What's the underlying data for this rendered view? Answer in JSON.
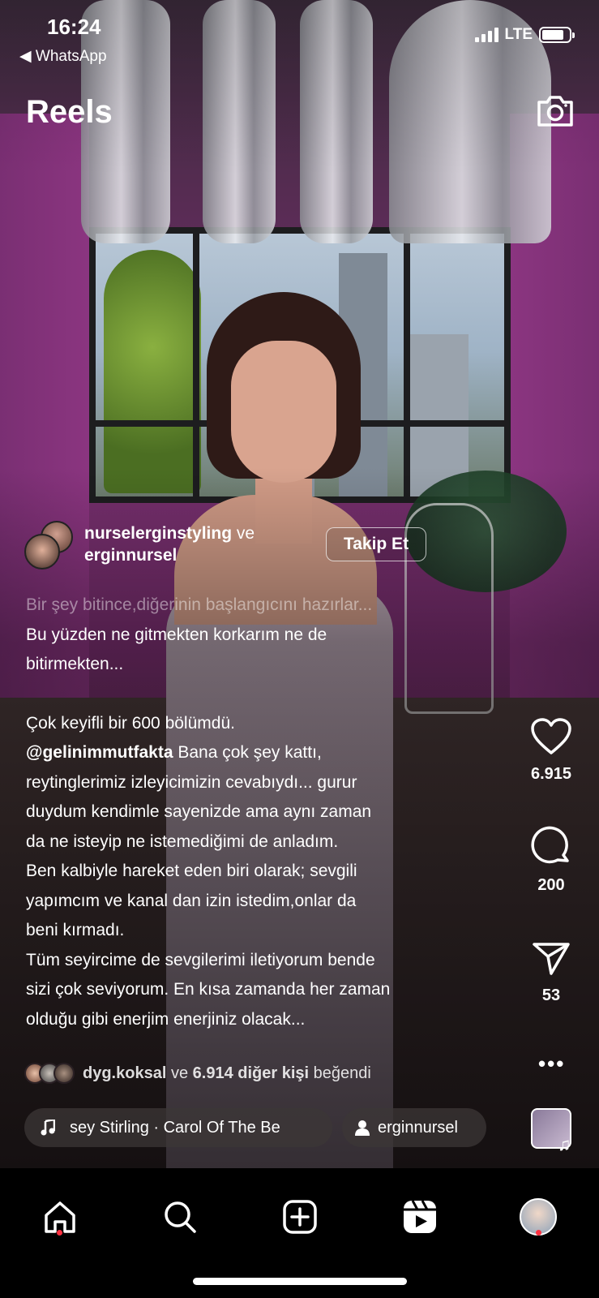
{
  "status_bar": {
    "time": "16:24",
    "back_app": "◀ WhatsApp",
    "network": "LTE"
  },
  "header": {
    "title": "Reels",
    "camera_icon": "camera-icon"
  },
  "author": {
    "name_1": "nurselerginstyling",
    "conjunction": " ve",
    "name_2": "erginnursel",
    "follow_label": "Takip Et"
  },
  "caption": {
    "line_faded": "Bir şey bitince,diğerinin başlangıcını hazırlar...",
    "para_1": "Bu yüzden ne gitmekten korkarım ne de\nbitirmekten...",
    "para_2": "Çok keyifli bir 600 bölümdü.",
    "mention": "@gelinimmutfakta",
    "para_3": " Bana çok şey kattı,\nreytinglerimiz izleyicimizin cevabıydı... gurur\nduydum kendimle sayenizde ama aynı zaman\nda ne isteyip ne istemediğimi de anladım.",
    "para_4": "Ben kalbiyle hareket eden biri olarak; sevgili\nyapımcım ve kanal dan izin istedim,onlar da\nbeni kırmadı.",
    "para_5": "Tüm seyircime de sevgilerimi iletiyorum bende\nsizi çok seviyorum. En kısa zamanda her zaman\nolduğu gibi enerjim enerjiniz olacak..."
  },
  "likes": {
    "user": "dyg.koksal",
    "and": " ve ",
    "others": "6.914 diğer kişi",
    "suffix": " beğendi"
  },
  "audio": {
    "track": "sey Stirling · Carol Of The Be",
    "user": "erginnursel"
  },
  "actions": {
    "like_count": "6.915",
    "comment_count": "200",
    "share_count": "53",
    "more": "•••"
  },
  "tabbar": {
    "items": [
      "home-icon",
      "search-icon",
      "create-icon",
      "reels-icon",
      "profile-avatar"
    ]
  },
  "colors": {
    "notification_dot": "#ff3040"
  }
}
